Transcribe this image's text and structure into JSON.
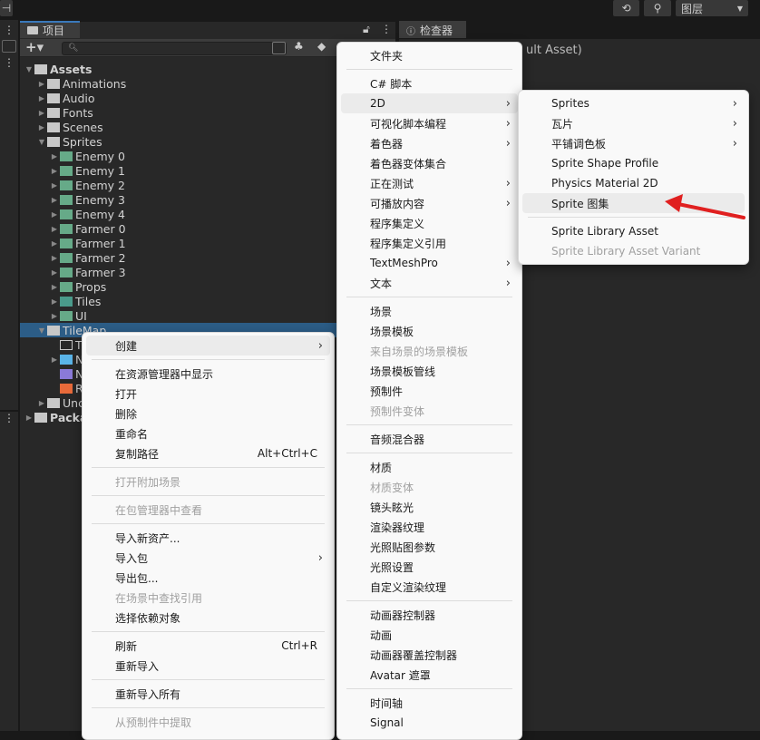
{
  "topbar": {
    "history_icon": "history-icon",
    "search_icon": "search-icon",
    "layers_label": "图层"
  },
  "project": {
    "tab_label": "项目",
    "add_label": "+▾",
    "tree": [
      {
        "label": "Assets",
        "depth": 0,
        "open": true,
        "bold": true,
        "icon": "folder-open"
      },
      {
        "label": "Animations",
        "depth": 1,
        "icon": "folder"
      },
      {
        "label": "Audio",
        "depth": 1,
        "icon": "folder"
      },
      {
        "label": "Fonts",
        "depth": 1,
        "icon": "folder"
      },
      {
        "label": "Scenes",
        "depth": 1,
        "icon": "folder"
      },
      {
        "label": "Sprites",
        "depth": 1,
        "open": true,
        "icon": "folder-open"
      },
      {
        "label": "Enemy 0",
        "depth": 2,
        "icon": "sprite"
      },
      {
        "label": "Enemy 1",
        "depth": 2,
        "icon": "sprite"
      },
      {
        "label": "Enemy 2",
        "depth": 2,
        "icon": "sprite"
      },
      {
        "label": "Enemy 3",
        "depth": 2,
        "icon": "sprite"
      },
      {
        "label": "Enemy 4",
        "depth": 2,
        "icon": "sprite"
      },
      {
        "label": "Farmer 0",
        "depth": 2,
        "icon": "sprite"
      },
      {
        "label": "Farmer 1",
        "depth": 2,
        "icon": "sprite"
      },
      {
        "label": "Farmer 2",
        "depth": 2,
        "icon": "sprite"
      },
      {
        "label": "Farmer 3",
        "depth": 2,
        "icon": "sprite"
      },
      {
        "label": "Props",
        "depth": 2,
        "icon": "sprite"
      },
      {
        "label": "Tiles",
        "depth": 2,
        "icon": "tiles"
      },
      {
        "label": "UI",
        "depth": 2,
        "icon": "sprite"
      },
      {
        "label": "TileMap",
        "depth": 1,
        "open": true,
        "selected": true,
        "icon": "folder-open"
      },
      {
        "label": "T",
        "depth": 2,
        "noarrow": true,
        "icon": "folder-empty"
      },
      {
        "label": "N",
        "depth": 2,
        "icon": "prefab"
      },
      {
        "label": "N",
        "depth": 2,
        "noarrow": true,
        "icon": "tilemap"
      },
      {
        "label": "R",
        "depth": 2,
        "noarrow": true,
        "icon": "script"
      },
      {
        "label": "Unc",
        "depth": 1,
        "icon": "folder"
      },
      {
        "label": "Packa",
        "depth": 0,
        "bold": true,
        "icon": "folder"
      }
    ]
  },
  "inspector": {
    "tab_label": "检查器",
    "title_fragment": "ult Asset)"
  },
  "context_menu": [
    {
      "label": "创建",
      "submenu": true,
      "highlight": true
    },
    {
      "sep": true
    },
    {
      "label": "在资源管理器中显示"
    },
    {
      "label": "打开"
    },
    {
      "label": "删除"
    },
    {
      "label": "重命名"
    },
    {
      "label": "复制路径",
      "shortcut": "Alt+Ctrl+C"
    },
    {
      "sep": true
    },
    {
      "label": "打开附加场景",
      "disabled": true
    },
    {
      "sep": true
    },
    {
      "label": "在包管理器中查看",
      "disabled": true
    },
    {
      "sep": true
    },
    {
      "label": "导入新资产..."
    },
    {
      "label": "导入包",
      "submenu": true
    },
    {
      "label": "导出包..."
    },
    {
      "label": "在场景中查找引用",
      "disabled": true
    },
    {
      "label": "选择依赖对象"
    },
    {
      "sep": true
    },
    {
      "label": "刷新",
      "shortcut": "Ctrl+R"
    },
    {
      "label": "重新导入"
    },
    {
      "sep": true
    },
    {
      "label": "重新导入所有"
    },
    {
      "sep": true
    },
    {
      "label": "从预制件中提取",
      "disabled": true
    }
  ],
  "create_menu": [
    {
      "label": "文件夹"
    },
    {
      "sep": true
    },
    {
      "label": "C# 脚本"
    },
    {
      "label": "2D",
      "submenu": true,
      "highlight": true
    },
    {
      "label": "可视化脚本编程",
      "submenu": true
    },
    {
      "label": "着色器",
      "submenu": true
    },
    {
      "label": "着色器变体集合"
    },
    {
      "label": "正在测试",
      "submenu": true
    },
    {
      "label": "可播放内容",
      "submenu": true
    },
    {
      "label": "程序集定义"
    },
    {
      "label": "程序集定义引用"
    },
    {
      "label": "TextMeshPro",
      "submenu": true
    },
    {
      "label": "文本",
      "submenu": true
    },
    {
      "sep": true
    },
    {
      "label": "场景"
    },
    {
      "label": "场景模板"
    },
    {
      "label": "来自场景的场景模板",
      "disabled": true
    },
    {
      "label": "场景模板管线"
    },
    {
      "label": "预制件"
    },
    {
      "label": "预制件变体",
      "disabled": true
    },
    {
      "sep": true
    },
    {
      "label": "音频混合器"
    },
    {
      "sep": true
    },
    {
      "label": "材质"
    },
    {
      "label": "材质变体",
      "disabled": true
    },
    {
      "label": "镜头眩光"
    },
    {
      "label": "渲染器纹理"
    },
    {
      "label": "光照贴图参数"
    },
    {
      "label": "光照设置"
    },
    {
      "label": "自定义渲染纹理"
    },
    {
      "sep": true
    },
    {
      "label": "动画器控制器"
    },
    {
      "label": "动画"
    },
    {
      "label": "动画器覆盖控制器"
    },
    {
      "label": "Avatar 遮罩"
    },
    {
      "sep": true
    },
    {
      "label": "时间轴"
    },
    {
      "label": "Signal"
    }
  ],
  "menu_2d": [
    {
      "label": "Sprites",
      "submenu": true
    },
    {
      "label": "瓦片",
      "submenu": true
    },
    {
      "label": "平铺调色板",
      "submenu": true
    },
    {
      "label": "Sprite Shape Profile"
    },
    {
      "label": "Physics Material 2D"
    },
    {
      "label": "Sprite 图集",
      "highlight": true
    },
    {
      "sep": true
    },
    {
      "label": "Sprite Library Asset"
    },
    {
      "label": "Sprite Library Asset Variant",
      "disabled": true
    }
  ],
  "colors": {
    "selection": "#2c5d87",
    "annotation_arrow": "#e02020",
    "menu_bg": "#f9f9f9"
  }
}
